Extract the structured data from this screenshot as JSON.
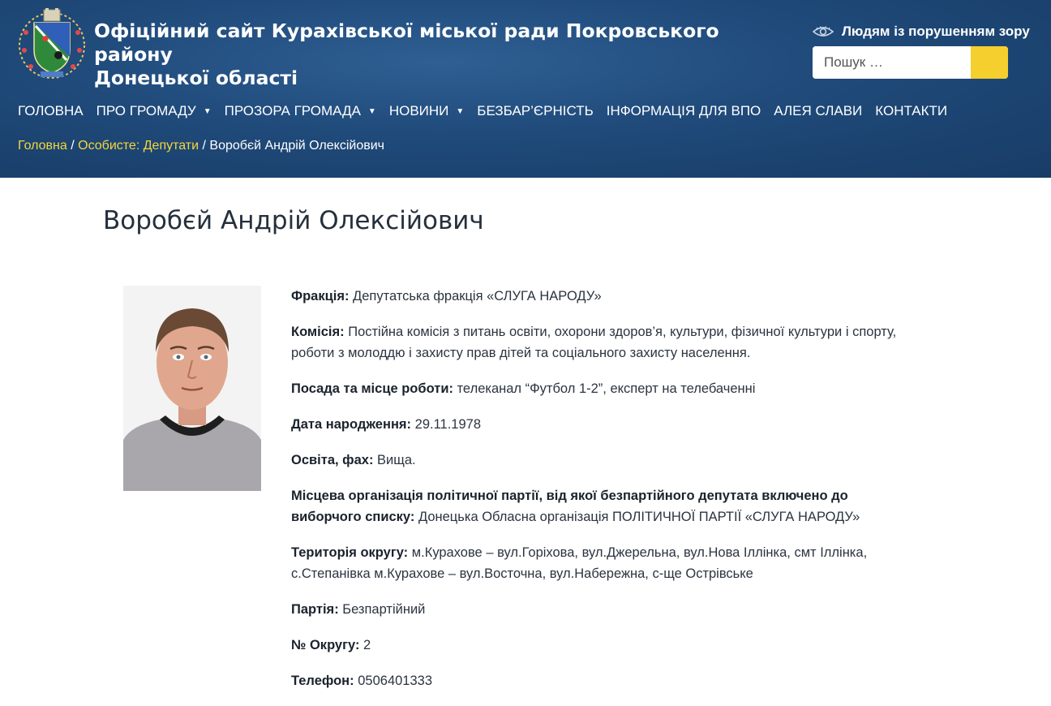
{
  "header": {
    "site_title_line1": "Офіційний сайт Курахівської міської ради Покровського району",
    "site_title_line2": "Донецької області",
    "accessibility_label": "Людям із порушенням зору",
    "search_placeholder": "Пошук …"
  },
  "nav": {
    "items": [
      {
        "label": "ГОЛОВНА"
      },
      {
        "label": "ПРО ГРОМАДУ",
        "caret": "▼"
      },
      {
        "label": "ПРОЗОРА ГРОМАДА",
        "caret": "▼"
      },
      {
        "label": "НОВИНИ",
        "caret": "▼"
      },
      {
        "label": "БЕЗБАР’ЄРНІСТЬ"
      },
      {
        "label": "ІНФОРМАЦІЯ ДЛЯ ВПО"
      },
      {
        "label": "АЛЕЯ СЛАВИ"
      },
      {
        "label": "КОНТАКТИ"
      }
    ]
  },
  "breadcrumb": {
    "home": "Головна",
    "section": "Особисте: Депутати",
    "separator": " / ",
    "current": "Воробєй Андрій Олексійович"
  },
  "page": {
    "title": "Воробєй Андрій Олексійович"
  },
  "details": [
    {
      "label": "Фракція:",
      "value": "Депутатська фракція «СЛУГА НАРОДУ»"
    },
    {
      "label": "Комісія:",
      "value": "Постійна комісія з питань освіти, охорони здоров’я, культури, фізичної культури і спорту, роботи з молоддю і захисту прав дітей та соціального захисту населення."
    },
    {
      "label": "Посада та місце роботи:",
      "value": "телеканал “Футбол 1-2”, експерт на телебаченні"
    },
    {
      "label": "Дата народження:",
      "value": "29.11.1978"
    },
    {
      "label": "Освіта, фах:",
      "value": "Вища."
    },
    {
      "label": "Місцева організація політичної партії, від якої безпартійного депутата включено до виборчого списку:",
      "value": "Донецька Обласна організація ПОЛІТИЧНОЇ ПАРТІЇ «СЛУГА НАРОДУ»"
    },
    {
      "label": "Територія округу:",
      "value": "м.Курахове – вул.Горіхова, вул.Джерельна, вул.Нова Іллінка, смт Іллінка, с.Степанівка м.Курахове – вул.Восточна, вул.Набережна, с-ще Острівське"
    },
    {
      "label": "Партія:",
      "value": "Безпартійний"
    },
    {
      "label": "№ Округу:",
      "value": "2"
    },
    {
      "label": "Телефон:",
      "value": "0506401333"
    }
  ],
  "colors": {
    "header_bg": "#1f4a7a",
    "breadcrumb_link": "#f5d63d",
    "search_button": "#f5cf2e"
  },
  "icons": {
    "logo": "coat-of-arms-icon",
    "accessibility": "eye-icon",
    "search_button": "search-button"
  }
}
